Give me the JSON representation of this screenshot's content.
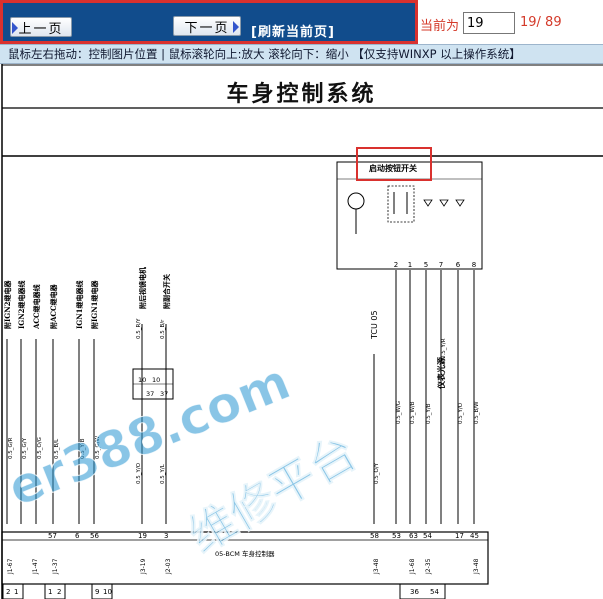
{
  "toolbar": {
    "prev_label": "上一页",
    "next_label": "下一页",
    "refresh_label": "[刷新当前页]",
    "current_label": "当前为",
    "current_page": "19",
    "page_count": "19/ 89"
  },
  "hint": "鼠标左右拖动：控制图片位置 | 鼠标滚轮向上:放大   滚轮向下：缩小 【仅支持WINXP 以上操作系统】",
  "diagram": {
    "title": "车身控制系统",
    "switch_box_label": "启动按钮开关",
    "tcu_label": "TCU 05",
    "bcm_label": "05-BCM 车身控制器",
    "vertical_labels": [
      "附IGN2继电器",
      "IGN2继电器线",
      "ACC继电器线",
      "附ACC继电器",
      "IGN1继电器线",
      "附IGN1继电器",
      "附后视镜电机",
      "附副合开关",
      "仪表光源"
    ],
    "pin_numbers_top": [
      "2",
      "1",
      "5",
      "7",
      "6",
      "8"
    ],
    "connector_pins_bottom": [
      "57",
      "56",
      "19",
      "3",
      "58",
      "53",
      "63",
      "54",
      "17",
      "45"
    ],
    "connector_names": [
      "J1-47",
      "J1-37",
      "J1-57",
      "J3-19",
      "J2-03",
      "J3-48",
      "J1-68",
      "J2-35",
      "J3-48"
    ],
    "wire_labels": [
      "0.5_G/R",
      "0.5_G/Y",
      "0.5_O/G",
      "0.5_B/L",
      "0.5_Y/B",
      "0.5_G/W",
      "0.5_Y/O",
      "0.5_Y/W",
      "0.5_R/G",
      "0.5_O/Y",
      "0.5_Y/O",
      "0.5_B/W"
    ],
    "small_box_pins": [
      "10",
      "10",
      "37",
      "37"
    ]
  },
  "watermark": {
    "text1": "er388.com",
    "text2": "维修平台"
  }
}
